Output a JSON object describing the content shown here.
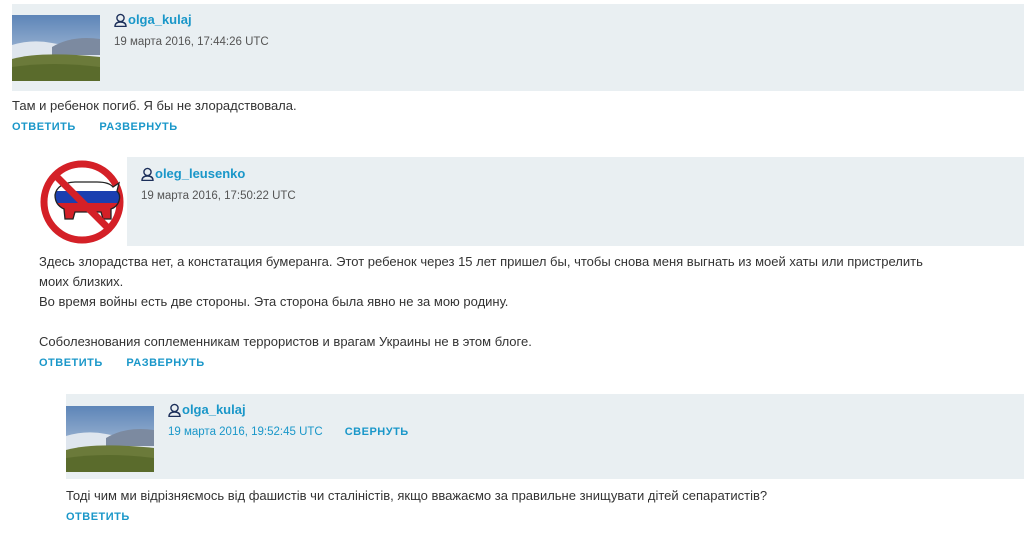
{
  "comments": [
    {
      "username": "olga_kulaj",
      "date": "19 марта 2016, 17:44:26 UTC",
      "text": [
        "Там и ребенок погиб. Я бы не злорадствовала."
      ],
      "reply": "ОТВЕТИТЬ",
      "expand": "РАЗВЕРНУТЬ"
    },
    {
      "username": "oleg_leusenko",
      "date": "19 марта 2016, 17:50:22 UTC",
      "text": [
        "Здесь злорадства нет, а констатация бумеранга. Этот ребенок через 15 лет пришел бы, чтобы снова меня выгнать из моей хаты или пристрелить",
        "моих близких.",
        "Во время войны есть две стороны. Эта сторона была явно не за мою родину.",
        "",
        "Соболезнования соплеменникам террористов и врагам Украины не в этом блоге."
      ],
      "reply": "ОТВЕТИТЬ",
      "expand": "РАЗВЕРНУТЬ"
    },
    {
      "username": "olga_kulaj",
      "date": "19 марта 2016, 19:52:45 UTC",
      "collapse": "СВЕРНУТЬ",
      "text": [
        "Тоді чим ми відрізняємось від фашистів чи сталіністів, якщо вважаємо за правильне знищувати дітей сепаратистів?"
      ],
      "reply": "ОТВЕТИТЬ"
    }
  ],
  "colors": {
    "link": "#1a97c9",
    "header_bg": "#e9eff2",
    "text": "#333333"
  },
  "icons": [
    "user-icon",
    "landscape-avatar",
    "no-russian-pig-avatar"
  ]
}
